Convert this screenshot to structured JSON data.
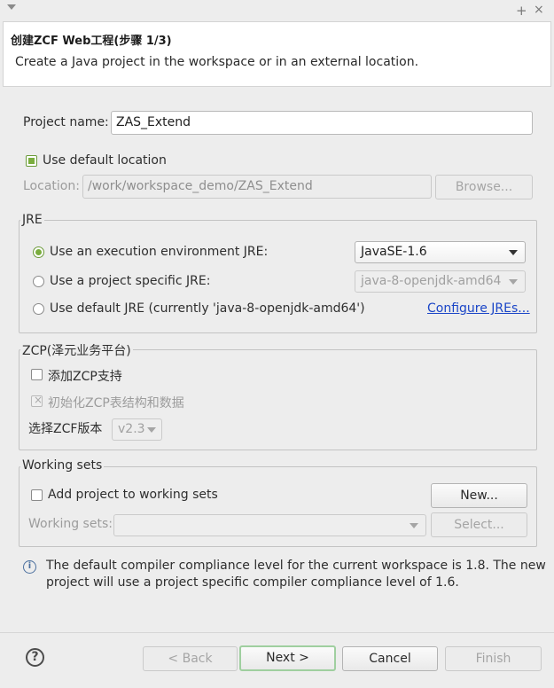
{
  "window": {
    "title": "创建ZCF Web工程(步骤 1/3)",
    "description": "Create a Java project in the workspace or in an external location.",
    "maximize_glyph": "+",
    "close_glyph": "×"
  },
  "project": {
    "name_label": "Project name:",
    "name_value": "ZAS_Extend",
    "use_default_location_label": "Use default location",
    "use_default_location_checked": true,
    "location_label": "Location:",
    "location_value": "/work/workspace_demo/ZAS_Extend",
    "browse_label": "Browse..."
  },
  "jre": {
    "group_label": "JRE",
    "option_execution_env": "Use an execution environment JRE:",
    "execution_env_value": "JavaSE-1.6",
    "option_project_specific": "Use a project specific JRE:",
    "project_specific_value": "java-8-openjdk-amd64",
    "option_default": "Use default JRE (currently 'java-8-openjdk-amd64')",
    "configure_link": "Configure JREs...",
    "selected": "execution_env"
  },
  "zcp": {
    "group_label": "ZCP(泽元业务平台)",
    "add_support_label": "添加ZCP支持",
    "add_support_checked": false,
    "init_label": "初始化ZCP表结构和数据",
    "version_label": "选择ZCF版本",
    "version_value": "v2.3"
  },
  "working_sets": {
    "group_label": "Working sets",
    "add_label": "Add project to working sets",
    "add_checked": false,
    "new_label": "New...",
    "sets_label": "Working sets:",
    "sets_value": "",
    "select_label": "Select..."
  },
  "info": {
    "icon": "info-icon",
    "line1": "The default compiler compliance level for the current workspace is 1.8. The new",
    "line2": "project will use a project specific compiler compliance level of 1.6."
  },
  "footer": {
    "help_glyph": "?",
    "back_label": "< Back",
    "next_label": "Next >",
    "cancel_label": "Cancel",
    "finish_label": "Finish"
  },
  "colors": {
    "accent_green": "#7aad3e",
    "link_blue": "#1a45c7",
    "background": "#ededed"
  }
}
